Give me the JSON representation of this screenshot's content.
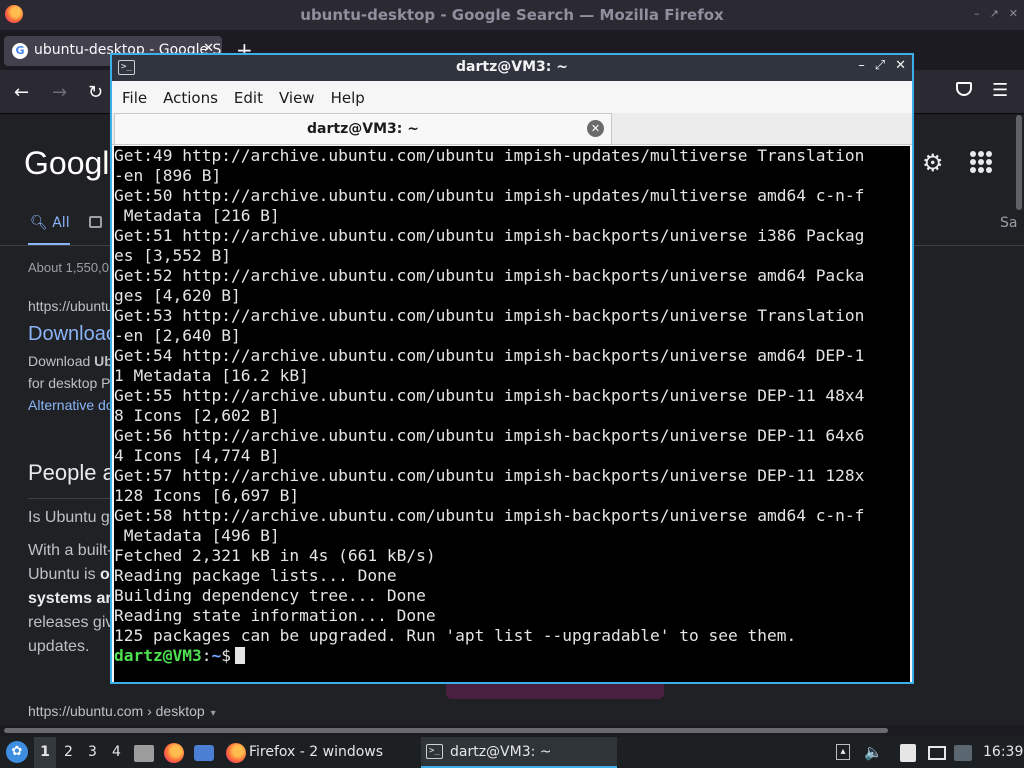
{
  "firefox": {
    "window_title": "ubuntu-desktop - Google Search — Mozilla Firefox",
    "tab_title": "ubuntu-desktop - Google Search",
    "tab_favicon": "G",
    "new_tab": "+",
    "close_tab": "✕",
    "back": "←",
    "forward": "→",
    "reload": "↻",
    "menu": "☰",
    "winctl": {
      "minimize": "–",
      "maximize": "↗",
      "close": "✕"
    }
  },
  "google": {
    "logo": "Google",
    "settings_icon": "⚙",
    "tab_all": "All",
    "tab_right": "Sa",
    "about": "About 1,550,0",
    "result_url": "https://ubuntu",
    "result_title": "Downloac",
    "result_desc_1_pre": "Download ",
    "result_desc_1_bold": "Ub",
    "result_desc_2": "for desktop P",
    "result_alt": "Alternative do",
    "people_also_ask": "People a",
    "question_1": "Is Ubuntu g",
    "answer_1": "With a built-",
    "answer_2_pre": "Ubuntu is ",
    "answer_2_bold": "o",
    "answer_3": "systems ar",
    "answer_4": "releases giv",
    "answer_5": "updates.",
    "bottom_url": "https://ubuntu.com › desktop",
    "bottom_caret": "▾"
  },
  "terminal": {
    "window_title": "dartz@VM3: ~",
    "icon_glyph": ">_",
    "winctl": {
      "minimize": "–",
      "maximize": "⤢",
      "close": "✕"
    },
    "menu": [
      "File",
      "Actions",
      "Edit",
      "View",
      "Help"
    ],
    "tab_label": "dartz@VM3: ~",
    "tab_close": "✕",
    "lines": [
      "Get:49 http://archive.ubuntu.com/ubuntu impish-updates/multiverse Translation",
      "-en [896 B]",
      "Get:50 http://archive.ubuntu.com/ubuntu impish-updates/multiverse amd64 c-n-f",
      " Metadata [216 B]",
      "Get:51 http://archive.ubuntu.com/ubuntu impish-backports/universe i386 Packag",
      "es [3,552 B]",
      "Get:52 http://archive.ubuntu.com/ubuntu impish-backports/universe amd64 Packa",
      "ges [4,620 B]",
      "Get:53 http://archive.ubuntu.com/ubuntu impish-backports/universe Translation",
      "-en [2,640 B]",
      "Get:54 http://archive.ubuntu.com/ubuntu impish-backports/universe amd64 DEP-1",
      "1 Metadata [16.2 kB]",
      "Get:55 http://archive.ubuntu.com/ubuntu impish-backports/universe DEP-11 48x4",
      "8 Icons [2,602 B]",
      "Get:56 http://archive.ubuntu.com/ubuntu impish-backports/universe DEP-11 64x6",
      "4 Icons [4,774 B]",
      "Get:57 http://archive.ubuntu.com/ubuntu impish-backports/universe DEP-11 128x",
      "128 Icons [6,697 B]",
      "Get:58 http://archive.ubuntu.com/ubuntu impish-backports/universe amd64 c-n-f",
      " Metadata [496 B]",
      "Fetched 2,321 kB in 4s (661 kB/s)",
      "Reading package lists... Done",
      "Building dependency tree... Done",
      "Reading state information... Done",
      "125 packages can be upgraded. Run 'apt list --upgradable' to see them."
    ],
    "prompt_user": "dartz@VM3",
    "prompt_sep": ":",
    "prompt_path": "~",
    "prompt_symbol": "$"
  },
  "taskbar": {
    "workspaces": [
      "1",
      "2",
      "3",
      "4"
    ],
    "task_firefox": "Firefox - 2 windows",
    "task_terminal": "dartz@VM3: ~",
    "terminal_icon_glyph": ">_",
    "tray_up": "▴",
    "volume": "🔈",
    "clock": "16:39"
  },
  "colors": {
    "terminal_bg": "#000000",
    "prompt_user": "#4fe04f",
    "prompt_path": "#6fa5ff",
    "accent": "#3daee9",
    "google_link": "#8ab4f8"
  }
}
